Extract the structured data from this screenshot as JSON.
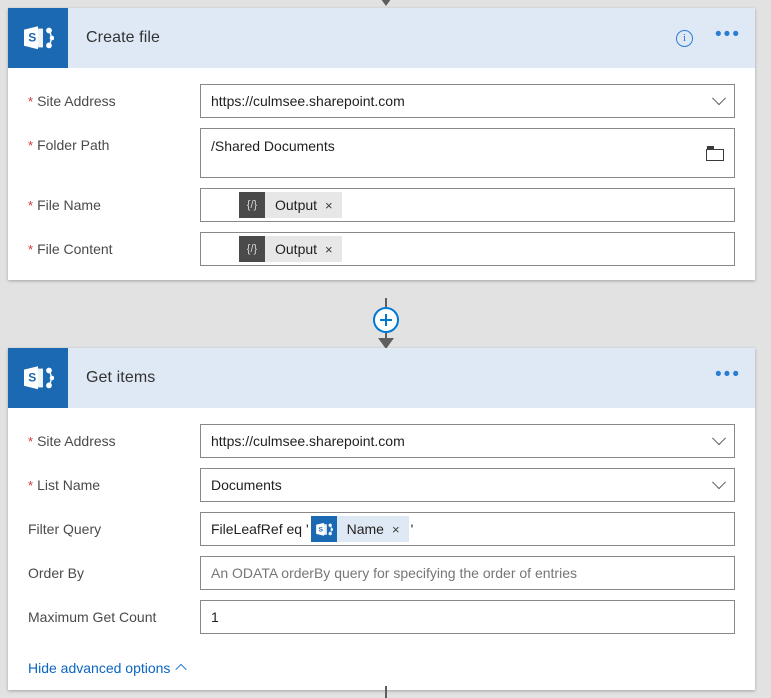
{
  "theme": {
    "canvas_bg": "#e2e2e2",
    "card_bg": "#ffffff",
    "header_bg": "#dfe9f5",
    "sharepoint_blue": "#1b68b3",
    "accent_blue": "#0a66c2",
    "required_red": "#d13438",
    "connector_gray": "#605e5c"
  },
  "connectors": {
    "top_arrow": "arrow-down-icon",
    "middle_add_label": "+",
    "middle_add_icon": "plus-circle-icon",
    "bottom_stub": "connector-line"
  },
  "cards": [
    {
      "id": "create-file",
      "icon": "sharepoint-icon",
      "title": "Create file",
      "actions": {
        "info": "information-icon",
        "menu": "•••"
      },
      "fields": [
        {
          "name": "site-address",
          "label": "Site Address",
          "required": true,
          "type": "combobox",
          "value": "https://culmsee.sharepoint.com",
          "placeholder": "",
          "affix": "chevron-down-icon"
        },
        {
          "name": "folder-path",
          "label": "Folder Path",
          "required": true,
          "type": "picker",
          "value": "/Shared Documents",
          "placeholder": "",
          "affix": "folder-icon",
          "tall": true
        },
        {
          "name": "file-name",
          "label": "File Name",
          "required": true,
          "type": "token",
          "value": "",
          "token": {
            "icon": "expression-icon",
            "icon_glyph": "{/}",
            "label": "Output",
            "remove": "×",
            "kind": "expression"
          }
        },
        {
          "name": "file-content",
          "label": "File Content",
          "required": true,
          "type": "token",
          "value": "",
          "token": {
            "icon": "expression-icon",
            "icon_glyph": "{/}",
            "label": "Output",
            "remove": "×",
            "kind": "expression"
          }
        }
      ]
    },
    {
      "id": "get-items",
      "icon": "sharepoint-icon",
      "title": "Get items",
      "actions": {
        "info": null,
        "menu": "•••"
      },
      "fields": [
        {
          "name": "site-address",
          "label": "Site Address",
          "required": true,
          "type": "combobox",
          "value": "https://culmsee.sharepoint.com",
          "placeholder": "",
          "affix": "chevron-down-icon"
        },
        {
          "name": "list-name",
          "label": "List Name",
          "required": true,
          "type": "combobox",
          "value": "Documents",
          "placeholder": "",
          "affix": "chevron-down-icon"
        },
        {
          "name": "filter-query",
          "label": "Filter Query",
          "required": false,
          "type": "rich",
          "prefix_text": "FileLeafRef eq '",
          "suffix_text": "'",
          "token": {
            "icon": "sharepoint-icon",
            "label": "Name",
            "remove": "×",
            "kind": "sharepoint"
          }
        },
        {
          "name": "order-by",
          "label": "Order By",
          "required": false,
          "type": "text",
          "value": "",
          "placeholder": "An ODATA orderBy query for specifying the order of entries"
        },
        {
          "name": "maximum-get-count",
          "label": "Maximum Get Count",
          "required": false,
          "type": "text",
          "value": "1",
          "placeholder": ""
        }
      ],
      "advanced_toggle": {
        "label": "Hide advanced options",
        "chevron": "chevron-up-icon"
      }
    }
  ]
}
